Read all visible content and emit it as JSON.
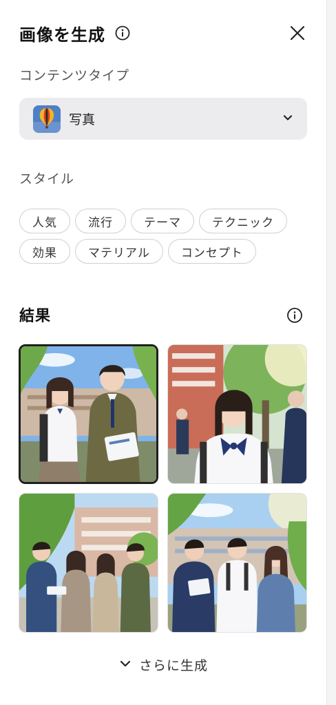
{
  "panel": {
    "title": "画像を生成",
    "icons": {
      "title_info": "info-icon",
      "close": "close-icon"
    }
  },
  "content_type": {
    "label": "コンテンツタイプ",
    "selected_value": "写真",
    "thumbnail_icon": "hot-air-balloon-thumbnail",
    "dropdown_icon": "chevron-down-icon"
  },
  "style": {
    "label": "スタイル",
    "chips": [
      "人気",
      "流行",
      "テーマ",
      "テクニック",
      "効果",
      "マテリアル",
      "コンセプト"
    ]
  },
  "results": {
    "title": "結果",
    "info_icon": "info-icon",
    "images": [
      {
        "id": 1,
        "selected": true
      },
      {
        "id": 2,
        "selected": false
      },
      {
        "id": 3,
        "selected": false
      },
      {
        "id": 4,
        "selected": false
      }
    ]
  },
  "footer": {
    "more_label": "さらに生成",
    "icon": "chevron-down-icon"
  }
}
